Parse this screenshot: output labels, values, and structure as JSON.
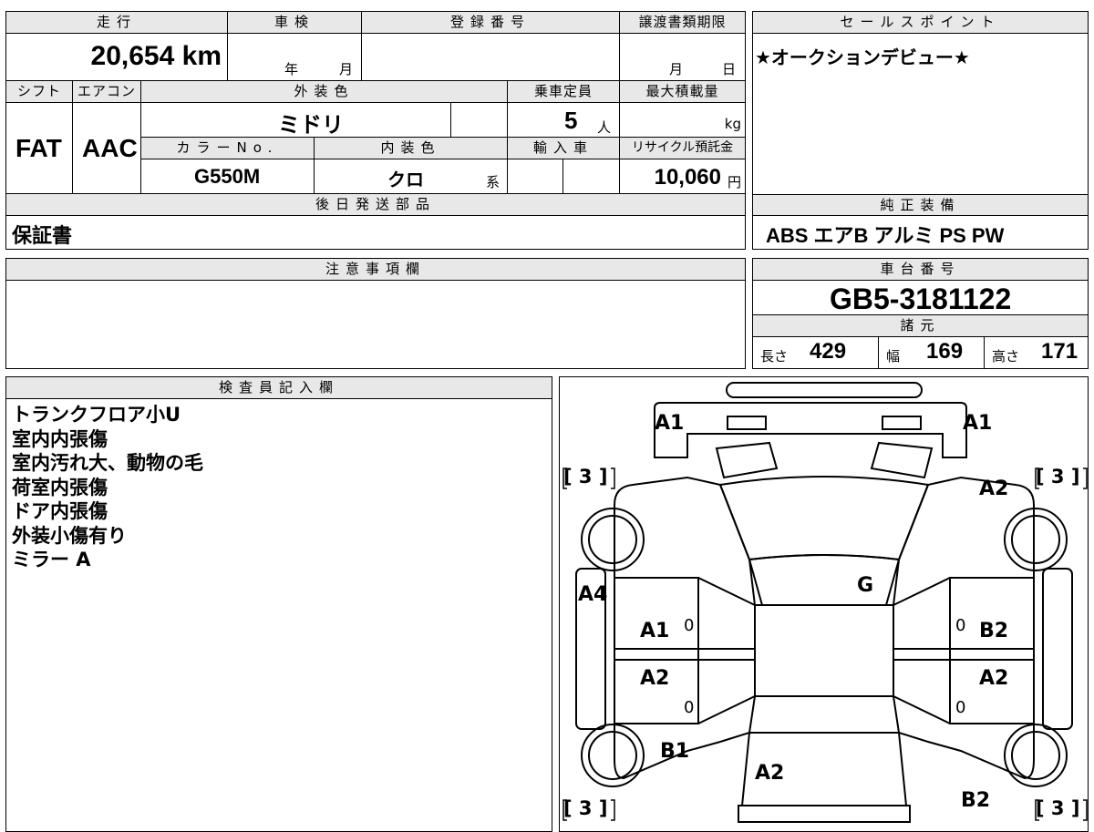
{
  "top": {
    "mileage_label": "走行",
    "mileage_value": "20,654 km",
    "shaken_label": "車検",
    "shaken_year": "年",
    "shaken_month": "月",
    "registration_label": "登録番号",
    "transfer_label": "譲渡書類期限",
    "transfer_month": "月",
    "transfer_day": "日",
    "shift_label": "シフト",
    "shift_value": "FAT",
    "aircon_label": "エアコン",
    "aircon_value": "AAC",
    "exterior_color_label": "外装色",
    "exterior_color_value": "ミドリ",
    "capacity_label": "乗車定員",
    "capacity_value": "5",
    "capacity_unit": "人",
    "max_load_label": "最大積載量",
    "max_load_unit": "kg",
    "color_no_label": "カラーNo.",
    "color_no_value": "G550M",
    "interior_color_label": "内装色",
    "interior_color_value": "クロ",
    "interior_color_unit": "系",
    "import_label": "輸入車",
    "recycle_label": "リサイクル預託金",
    "recycle_value": "10,060",
    "recycle_unit": "円",
    "later_parts_label": "後日発送部品",
    "later_parts_value": "保証書"
  },
  "sales_points": {
    "label": "セールスポイント",
    "text": "★オークションデビュー★"
  },
  "equipment": {
    "label": "純正装備",
    "items": "ABS エアB アルミ PS PW"
  },
  "notes": {
    "label": "注意事項欄",
    "text": ""
  },
  "chassis": {
    "label": "車台番号",
    "value": "GB5-3181122"
  },
  "specs": {
    "label": "諸元",
    "length_label": "長さ",
    "length_value": "429",
    "width_label": "幅",
    "width_value": "169",
    "height_label": "高さ",
    "height_value": "171"
  },
  "inspector": {
    "label": "検査員記入欄",
    "lines": [
      "トランクフロア小U",
      "室内内張傷",
      "室内汚れ大、動物の毛",
      "荷室内張傷",
      "ドア内張傷",
      "外装小傷有り",
      "ミラー A"
    ]
  },
  "diagram": {
    "marks": {
      "front_left": "A1",
      "front_right": "A1",
      "tire_fl": "[ 3 ]",
      "tire_fr": "[ 3 ]",
      "fender_r": "A2",
      "glass": "G",
      "side_left": "A4",
      "front_door_left": "A1",
      "front_door_left_num": "0",
      "front_door_right": "B2",
      "front_door_right_num": "0",
      "rear_door_left": "A2",
      "rear_door_left_num": "0",
      "rear_door_right": "A2",
      "rear_door_right_num": "0",
      "rear_fender_left": "B1",
      "roof_rear": "A2",
      "rear_fender_right": "B2",
      "tire_rl": "[ 3 ]",
      "tire_rr": "[ 3 ]"
    }
  }
}
